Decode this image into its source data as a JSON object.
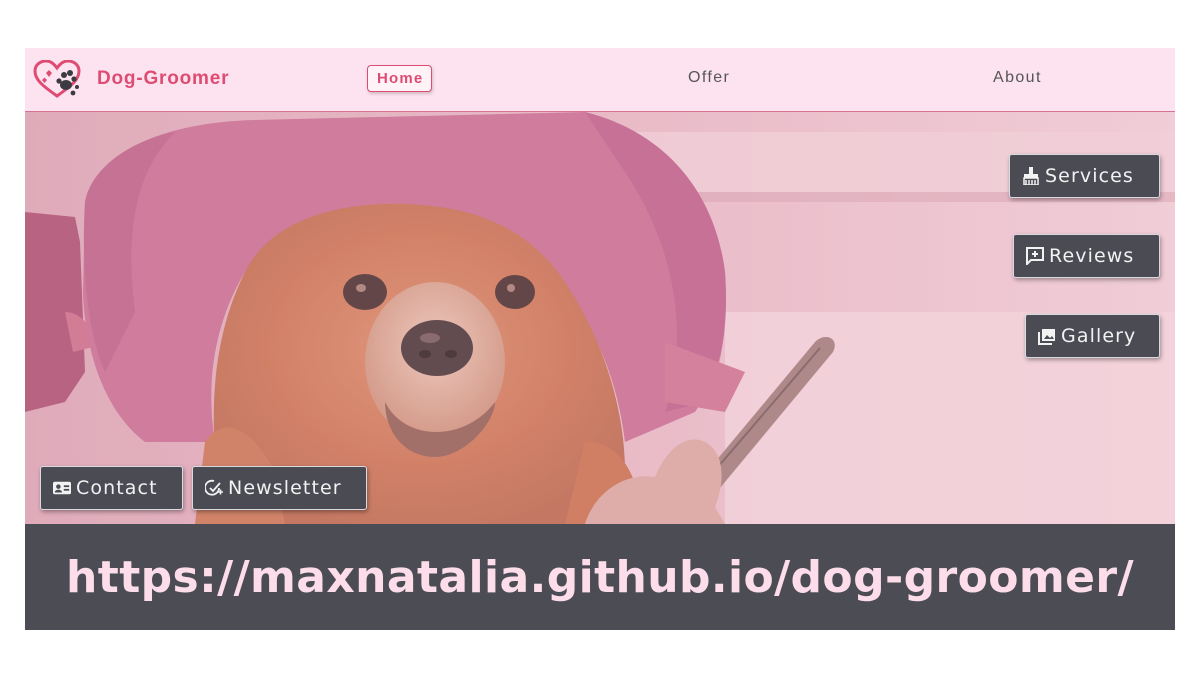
{
  "brand": {
    "name": "Dog-Groomer",
    "logo_icon": "heart-paw-logo-icon"
  },
  "nav": {
    "home": "Home",
    "offer": "Offer",
    "about": "About"
  },
  "side_buttons": {
    "services": {
      "label": "Services",
      "icon": "brush-icon"
    },
    "reviews": {
      "label": "Reviews",
      "icon": "review-plus-icon"
    },
    "gallery": {
      "label": "Gallery",
      "icon": "image-icon"
    }
  },
  "bottom_buttons": {
    "contact": {
      "label": "Contact",
      "icon": "contact-card-icon"
    },
    "newsletter": {
      "label": "Newsletter",
      "icon": "mail-check-icon"
    }
  },
  "url_caption": "https://maxnatalia.github.io/dog-groomer/",
  "colors": {
    "brand": "#de4c73",
    "navbar_bg": "#fde3ef",
    "button_bg": "#4a4b53",
    "caption_bg": "#4c4c55",
    "caption_text": "#fcdde9"
  }
}
